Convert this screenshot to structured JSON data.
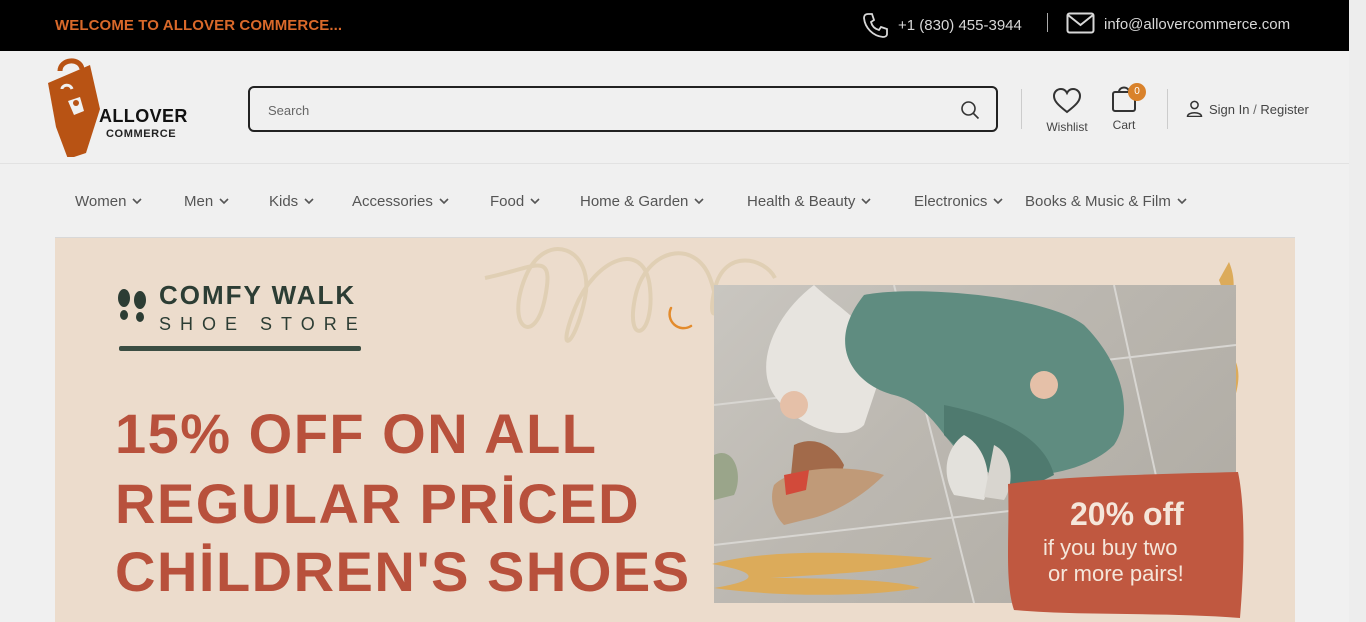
{
  "topbar": {
    "welcome": "WELCOME TO ALLOVER COMMERCE...",
    "phone": "+1 (830) 455-3944",
    "email": "info@allovercommerce.com"
  },
  "logo": {
    "line1": "ALLOVER",
    "line2": "COMMERCE"
  },
  "search": {
    "placeholder": "Search",
    "value": ""
  },
  "header": {
    "wishlist_label": "Wishlist",
    "cart_label": "Cart",
    "cart_count": "0",
    "sign_in": "Sign In",
    "separator": "/",
    "register": "Register"
  },
  "nav": {
    "items": [
      {
        "label": "Women"
      },
      {
        "label": "Men"
      },
      {
        "label": "Kids"
      },
      {
        "label": "Accessories"
      },
      {
        "label": "Food"
      },
      {
        "label": "Home & Garden"
      },
      {
        "label": "Health & Beauty"
      },
      {
        "label": "Electronics"
      },
      {
        "label": "Books & Music & Film"
      }
    ]
  },
  "banner": {
    "brand_line1": "COMFY WALK",
    "brand_line2": "SHOE STORE",
    "headline_1": "15% OFF ON ALL",
    "headline_2": "REGULAR PRİCED",
    "headline_3": "CHİLDREN'S SHOES",
    "promo_big": "20% off",
    "promo_line1": "if you buy two",
    "promo_line2": "or more pairs!"
  },
  "colors": {
    "accent": "#d9692a",
    "headline": "#b8513c",
    "promo": "#c05840",
    "topbar_bg": "#000000"
  }
}
